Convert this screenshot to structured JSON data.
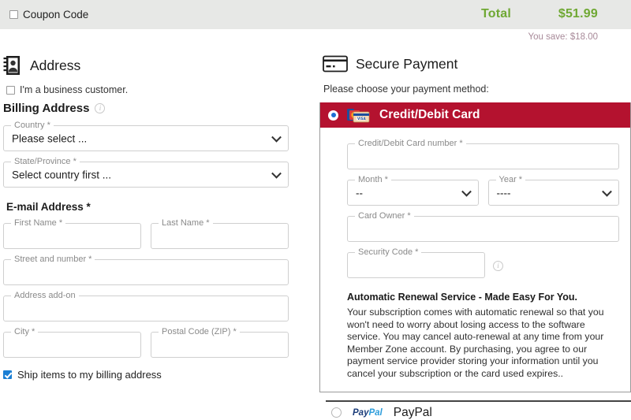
{
  "topbar": {
    "coupon_label": "Coupon Code",
    "coupon_checkbox_icon": "checkbox-unchecked-icon",
    "total_label": "Total",
    "total_value": "$51.99",
    "you_save": "You save: $18.00",
    "total_color": "#6fa833",
    "you_save_color": "#a88a99",
    "bar_color": "#e7e8e6"
  },
  "address": {
    "icon": "address-book-icon",
    "title": "Address",
    "business_checkbox_label": "I'm a business customer.",
    "billing_title": "Billing Address",
    "billing_info_icon": "info-circle-icon",
    "fields": {
      "country": {
        "label": "Country *",
        "value": "Please select ...",
        "type": "select",
        "chevron": "chevron-down-icon"
      },
      "state": {
        "label": "State/Province *",
        "value": "Select country first ...",
        "type": "select",
        "chevron": "chevron-down-icon"
      },
      "email_heading": "E-mail Address *",
      "first_name": {
        "label": "First Name *",
        "value": ""
      },
      "last_name": {
        "label": "Last Name *",
        "value": ""
      },
      "street": {
        "label": "Street and number *",
        "value": ""
      },
      "addon": {
        "label": "Address add-on",
        "value": ""
      },
      "city": {
        "label": "City *",
        "value": ""
      },
      "zip": {
        "label": "Postal Code (ZIP) *",
        "value": ""
      }
    },
    "ship_checkbox_label": "Ship items to my billing address",
    "ship_checked": true,
    "checkbox_accent": "#1b7fd4"
  },
  "payment": {
    "icon": "credit-card-icon",
    "title": "Secure Payment",
    "choose_text": "Please choose your payment method:",
    "methods": [
      {
        "id": "credit-debit-card",
        "label": "Credit/Debit Card",
        "selected": true,
        "brand_icon": "card-brands-icon",
        "header_color": "#b4122f",
        "fields": {
          "card_number": {
            "label": "Credit/Debit Card number *",
            "value": ""
          },
          "month": {
            "label": "Month *",
            "value": "--",
            "type": "select",
            "chevron": "chevron-down-icon"
          },
          "year": {
            "label": "Year *",
            "value": "----",
            "type": "select",
            "chevron": "chevron-down-icon"
          },
          "card_owner": {
            "label": "Card Owner *",
            "value": ""
          },
          "security_code": {
            "label": "Security Code *",
            "value": "",
            "info_icon": "info-circle-icon"
          }
        },
        "renewal_heading": "Automatic Renewal Service - Made Easy For You.",
        "renewal_text": "Your subscription comes with automatic renewal so that you won't need to worry about losing access to the software service. You may cancel auto-renewal at any time from your Member Zone account. By purchasing, you agree to our payment service provider storing your information until you cancel your subscription or the card used expires.."
      },
      {
        "id": "paypal",
        "label": "PayPal",
        "selected": false,
        "brand_icon": "paypal-logo-icon",
        "logo_part_1": "Pay",
        "logo_part_2": "Pal"
      }
    ]
  }
}
